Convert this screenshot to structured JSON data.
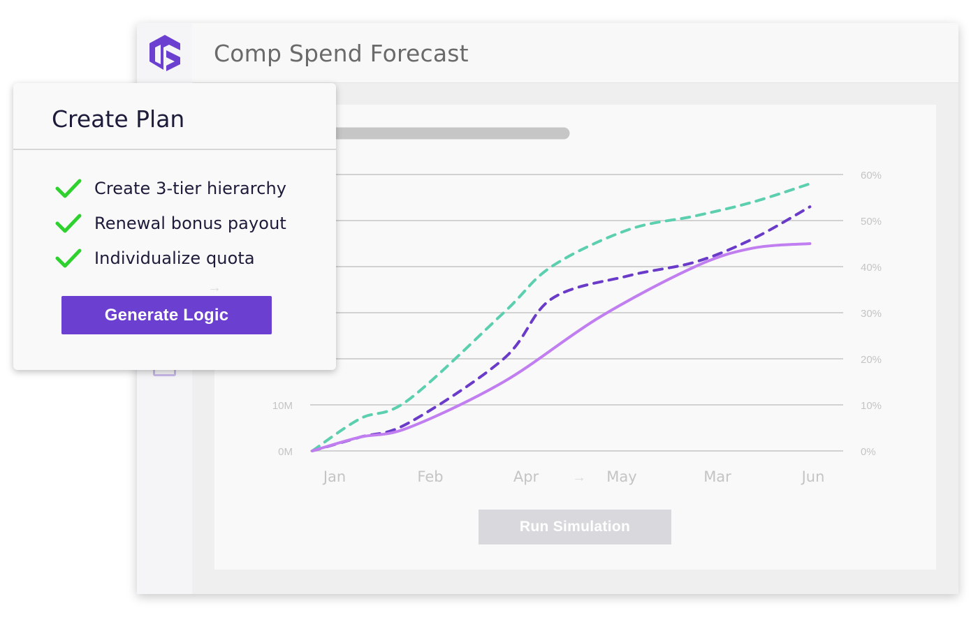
{
  "app": {
    "title": "Comp Spend Forecast",
    "brand_color": "#6b3fcf",
    "logo_icon": "brand-logo-icon"
  },
  "popover": {
    "title": "Create Plan",
    "items": [
      {
        "label": "Create 3-tier hierarchy",
        "icon": "check-icon"
      },
      {
        "label": "Renewal bonus payout",
        "icon": "check-icon"
      },
      {
        "label": "Individualize quota",
        "icon": "check-icon"
      }
    ],
    "button_label": "Generate Logic",
    "check_color": "#2fd12f"
  },
  "simulation": {
    "button_label": "Run Simulation"
  },
  "chart_data": {
    "type": "line",
    "categories": [
      "Jan",
      "Feb",
      "Apr",
      "May",
      "Mar",
      "Jun"
    ],
    "y_left_ticks": [
      "0M",
      "10M"
    ],
    "y_right_ticks": [
      "0%",
      "10%",
      "20%",
      "30%",
      "40%",
      "50%",
      "60%"
    ],
    "ylim": [
      0,
      60
    ],
    "grid": true,
    "series": [
      {
        "style": "dashed",
        "color": "#5ccfae",
        "values": [
          [
            0.0,
            0
          ],
          [
            0.5,
            7
          ],
          [
            1.0,
            11
          ],
          [
            2.0,
            30
          ],
          [
            2.5,
            40
          ],
          [
            3.3,
            48
          ],
          [
            4.0,
            51
          ],
          [
            4.6,
            54
          ],
          [
            5.2,
            58
          ]
        ]
      },
      {
        "style": "dashed",
        "color": "#6a3bc9",
        "values": [
          [
            0.0,
            0
          ],
          [
            0.5,
            3
          ],
          [
            1.0,
            6
          ],
          [
            2.0,
            20
          ],
          [
            2.5,
            33
          ],
          [
            3.3,
            38
          ],
          [
            4.0,
            41
          ],
          [
            4.6,
            46
          ],
          [
            5.2,
            53
          ]
        ]
      },
      {
        "style": "solid",
        "color": "#c07ef0",
        "values": [
          [
            0.0,
            0
          ],
          [
            0.5,
            3
          ],
          [
            1.0,
            5
          ],
          [
            2.0,
            15
          ],
          [
            3.0,
            29
          ],
          [
            4.0,
            40
          ],
          [
            4.6,
            44
          ],
          [
            5.2,
            45
          ]
        ]
      }
    ]
  }
}
